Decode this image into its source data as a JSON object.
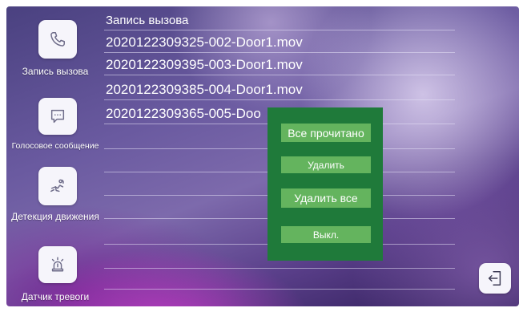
{
  "sidebar": {
    "items": [
      {
        "label": "Запись вызова",
        "icon": "phone-icon"
      },
      {
        "label": "Голосовое сообщение",
        "icon": "message-icon"
      },
      {
        "label": "Детекция движения",
        "icon": "motion-icon"
      },
      {
        "label": "Датчик тревоги",
        "icon": "alarm-icon"
      }
    ]
  },
  "list": {
    "title": "Запись вызова",
    "records": [
      "2020122309325-002-Door1.mov",
      "2020122309395-003-Door1.mov",
      "2020122309385-004-Door1.mov",
      "2020122309365-005-Doo"
    ]
  },
  "context_menu": {
    "read_all": "Все прочитано",
    "delete": "Удалить",
    "delete_all": "Удалить все",
    "off": "Выкл."
  },
  "exit": {
    "icon": "exit-icon"
  },
  "colors": {
    "menu_bg": "#1f7a3a",
    "menu_button": "#64b45e",
    "tile": "#f6f5fb"
  }
}
